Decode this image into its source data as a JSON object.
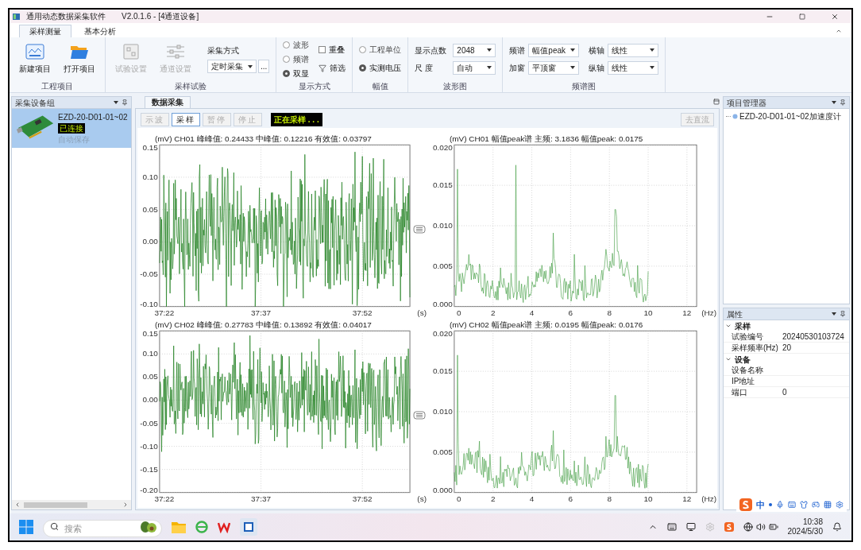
{
  "window": {
    "title": "通用动态数据采集软件",
    "version": "V2.0.1.6 - [4通道设备]"
  },
  "ribbon_tabs": [
    {
      "label": "采样测量",
      "selected": true
    },
    {
      "label": "基本分析",
      "selected": false
    }
  ],
  "ribbon": {
    "project": {
      "caption": "工程项目",
      "buttons": [
        {
          "label": "新建项目",
          "kind": "new"
        },
        {
          "label": "打开项目",
          "kind": "open"
        }
      ]
    },
    "sampling": {
      "caption": "采样试验",
      "buttons": [
        {
          "label": "试验设置",
          "kind": "test",
          "disabled": true
        },
        {
          "label": "通道设置",
          "kind": "channel",
          "disabled": true
        }
      ],
      "mode_label": "采集方式",
      "mode_value": "定时采集",
      "more": "..."
    },
    "display": {
      "caption": "显示方式",
      "radios": [
        {
          "label": "波形",
          "selected": false
        },
        {
          "label": "频谱",
          "selected": false
        },
        {
          "label": "双显",
          "selected": true
        }
      ],
      "overlay": {
        "label": "重叠",
        "checked": false
      },
      "filter": "筛选"
    },
    "amplitude": {
      "caption": "幅值",
      "radios": [
        {
          "label": "工程单位",
          "selected": false
        },
        {
          "label": "实测电压",
          "selected": true
        }
      ]
    },
    "waveform": {
      "caption": "波形图",
      "fields": [
        {
          "label": "显示点数",
          "value": "2048"
        },
        {
          "label": "尺 度",
          "value": "自动"
        }
      ]
    },
    "spectrum": {
      "caption": "频谱图",
      "fields": [
        {
          "label": "频谱",
          "value": "幅值peak"
        },
        {
          "label": "加窗",
          "value": "平顶窗"
        },
        {
          "label": "横轴",
          "value": "线性"
        },
        {
          "label": "纵轴",
          "value": "线性"
        }
      ]
    }
  },
  "device_panel": {
    "title": "采集设备组",
    "devices": [
      {
        "name": "EZD-20-D01-01~02",
        "status": "已连接",
        "note": "自动保存",
        "selected": true
      }
    ]
  },
  "data_tab": {
    "tab": "数据采集",
    "buttons": [
      {
        "label": "示波",
        "disabled": true,
        "selected": false
      },
      {
        "label": "采样",
        "disabled": false,
        "selected": true
      },
      {
        "label": "暂停",
        "disabled": true,
        "selected": false
      },
      {
        "label": "停止",
        "disabled": true,
        "selected": false
      }
    ],
    "status": "正在采样 . . .",
    "dc_button": {
      "label": "去直流",
      "disabled": true
    }
  },
  "charts": [
    {
      "kind": "waveform",
      "header": "(mV)   CH01 峰峰值: 0.24433 中峰值: 0.12216 有效值: 0.03797",
      "y_ticks": [
        "0.15",
        "0.10",
        "0.05",
        "0.00",
        "-0.05",
        "-0.10"
      ],
      "x_ticks": [
        "37:22",
        "37:37",
        "37:52"
      ],
      "x_unit": "(s)"
    },
    {
      "kind": "spectrum",
      "header": "(mV)   CH01 幅值peak谱 主频: 3.1836 幅值peak: 0.0175",
      "y_ticks": [
        "0.020",
        "0.015",
        "0.010",
        "0.005",
        "0.000"
      ],
      "x_ticks": [
        "0",
        "2",
        "4",
        "6",
        "8",
        "10",
        "12"
      ],
      "x_unit": "(Hz)"
    },
    {
      "kind": "waveform",
      "header": "(mV)   CH02 峰峰值: 0.27783 中峰值: 0.13892 有效值: 0.04017",
      "y_ticks": [
        "0.15",
        "0.10",
        "0.05",
        "0.00",
        "-0.05",
        "-0.10",
        "-0.15",
        "-0.20"
      ],
      "x_ticks": [
        "37:22",
        "37:37",
        "37:52"
      ],
      "x_unit": "(s)"
    },
    {
      "kind": "spectrum",
      "header": "(mV)   CH02 幅值peak谱 主频: 0.0195 幅值peak: 0.0176",
      "y_ticks": [
        "0.020",
        "0.015",
        "0.010",
        "0.005",
        "0.000"
      ],
      "x_ticks": [
        "0",
        "2",
        "4",
        "6",
        "8",
        "10",
        "12"
      ],
      "x_unit": "(Hz)"
    }
  ],
  "project_manager": {
    "title": "项目管理器",
    "items": [
      {
        "label": "EZD-20-D01-01~02加速度计"
      }
    ]
  },
  "properties": {
    "title": "属性",
    "categories": [
      {
        "name": "采样",
        "expanded": true,
        "rows": [
          {
            "key": "试验编号",
            "value": "20240530103724"
          },
          {
            "key": "采样频率(Hz)",
            "value": "20"
          }
        ]
      },
      {
        "name": "设备",
        "expanded": true,
        "rows": [
          {
            "key": "设备名称"
          },
          {
            "key": "IP地址"
          },
          {
            "key": "端口",
            "value": "0"
          }
        ]
      }
    ]
  },
  "ime": {
    "mode": "中"
  },
  "taskbar": {
    "search_placeholder": "搜索",
    "time": "10:38",
    "date": "2024/5/30"
  }
}
